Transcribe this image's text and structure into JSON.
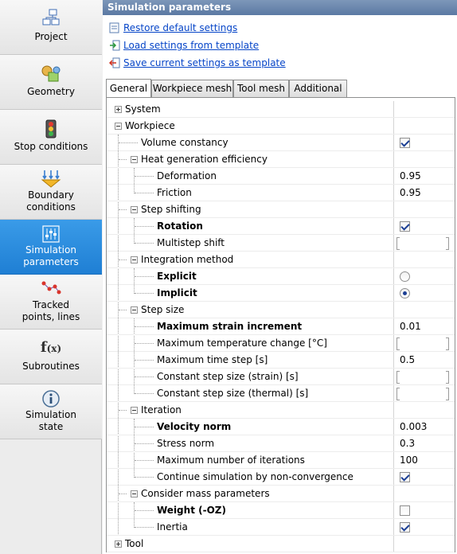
{
  "sidebar": {
    "items": [
      {
        "label": "Project",
        "icon": "project-tree-icon"
      },
      {
        "label": "Geometry",
        "icon": "geometry-shapes-icon"
      },
      {
        "label": "Stop conditions",
        "icon": "traffic-light-icon"
      },
      {
        "label": "Boundary conditions",
        "label_lines": [
          "Boundary",
          "conditions"
        ],
        "icon": "boundary-arrows-icon"
      },
      {
        "label": "Simulation parameters",
        "label_lines": [
          "Simulation",
          "parameters"
        ],
        "icon": "sliders-icon",
        "active": true
      },
      {
        "label": "Tracked points, lines",
        "label_lines": [
          "Tracked",
          "points, lines"
        ],
        "icon": "tracked-points-icon"
      },
      {
        "label": "Subroutines",
        "icon": "function-icon"
      },
      {
        "label": "Simulation state",
        "label_lines": [
          "Simulation",
          "state"
        ],
        "icon": "info-icon"
      }
    ]
  },
  "panel": {
    "title": "Simulation parameters",
    "actions": [
      {
        "label": "Restore default settings",
        "icon": "restore-icon"
      },
      {
        "label": "Load settings from template",
        "icon": "load-arrow-icon"
      },
      {
        "label": "Save current settings as template",
        "icon": "save-arrow-icon"
      }
    ]
  },
  "tabs": [
    "General",
    "Workpiece mesh",
    "Tool mesh",
    "Additional"
  ],
  "active_tab": "General",
  "tree": {
    "system": "System",
    "workpiece": "Workpiece",
    "volume_constancy": "Volume constancy",
    "heat_gen": "Heat generation efficiency",
    "deformation": "Deformation",
    "deformation_value": "0.95",
    "friction": "Friction",
    "friction_value": "0.95",
    "step_shifting": "Step shifting",
    "rotation": "Rotation",
    "multistep_shift": "Multistep shift",
    "integration_method": "Integration method",
    "explicit": "Explicit",
    "implicit": "Implicit",
    "step_size": "Step size",
    "max_strain_increment": "Maximum strain increment",
    "max_strain_increment_value": "0.01",
    "max_temp_change": "Maximum temperature change [°C]",
    "max_time_step": "Maximum time step [s]",
    "max_time_step_value": "0.5",
    "const_step_strain": "Constant step size (strain) [s]",
    "const_step_thermal": "Constant step size (thermal) [s]",
    "iteration": "Iteration",
    "velocity_norm": "Velocity norm",
    "velocity_norm_value": "0.003",
    "stress_norm": "Stress norm",
    "stress_norm_value": "0.3",
    "max_iterations": "Maximum number of iterations",
    "max_iterations_value": "100",
    "continue_nonconv": "Continue simulation by non-convergence",
    "consider_mass": "Consider mass parameters",
    "weight": "Weight (-OZ)",
    "inertia": "Inertia",
    "tool": "Tool"
  },
  "states": {
    "volume_constancy": true,
    "rotation": true,
    "integration": "Implicit",
    "continue_nonconv": true,
    "weight": false,
    "inertia": true
  },
  "colors": {
    "active_nav": "#2a8ae0",
    "link": "#0645c8",
    "title_bar": "#6b86ad"
  }
}
